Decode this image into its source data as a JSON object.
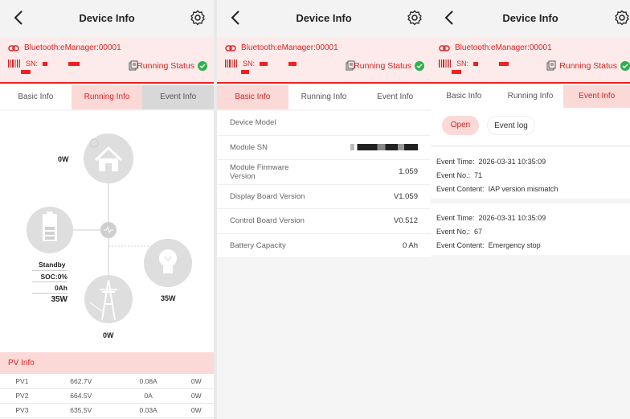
{
  "header": {
    "title": "Device Info"
  },
  "info": {
    "bluetooth": "Bluetooth:eManager:00001",
    "sn_label": "SN:",
    "running_status": "Running Status"
  },
  "tabs": [
    "Basic Info",
    "Running Info",
    "Event Info"
  ],
  "running": {
    "pv_power": "0W",
    "battery_status": "Standby",
    "soc": "SOC:0%",
    "battery_ah": "0Ah",
    "battery_power": "35W",
    "load_power": "35W",
    "grid_power": "0W",
    "pv_info_title": "PV Info",
    "pv_rows": [
      [
        "PV1",
        "662.7V",
        "0.08A",
        "0W"
      ],
      [
        "PV2",
        "664.5V",
        "0A",
        "0W"
      ],
      [
        "PV3",
        "635.5V",
        "0.03A",
        "0W"
      ]
    ]
  },
  "basic": {
    "rows": [
      {
        "label": "Device Model",
        "value": ""
      },
      {
        "label": "Module SN",
        "value": ""
      },
      {
        "label": "Module Firmware Version",
        "value": "1.059"
      },
      {
        "label": "Display Board Version",
        "value": "V1.059"
      },
      {
        "label": "Control Board Version",
        "value": "V0.512"
      },
      {
        "label": "Battery Capacity",
        "value": "0 Ah"
      }
    ]
  },
  "events": {
    "open_label": "Open",
    "log_label": "Event log",
    "time_label": "Event Time:",
    "no_label": "Event No.:",
    "content_label": "Event Content:",
    "items": [
      {
        "time": "2026-03-31 10:35:09",
        "no": "71",
        "content": "IAP version mismatch"
      },
      {
        "time": "2026-03-31 10:35:09",
        "no": "67",
        "content": "Emergency stop"
      }
    ]
  },
  "colors": {
    "accent": "#dd2222",
    "accent_bg": "#fad9d7",
    "ok": "#2bb34b"
  }
}
